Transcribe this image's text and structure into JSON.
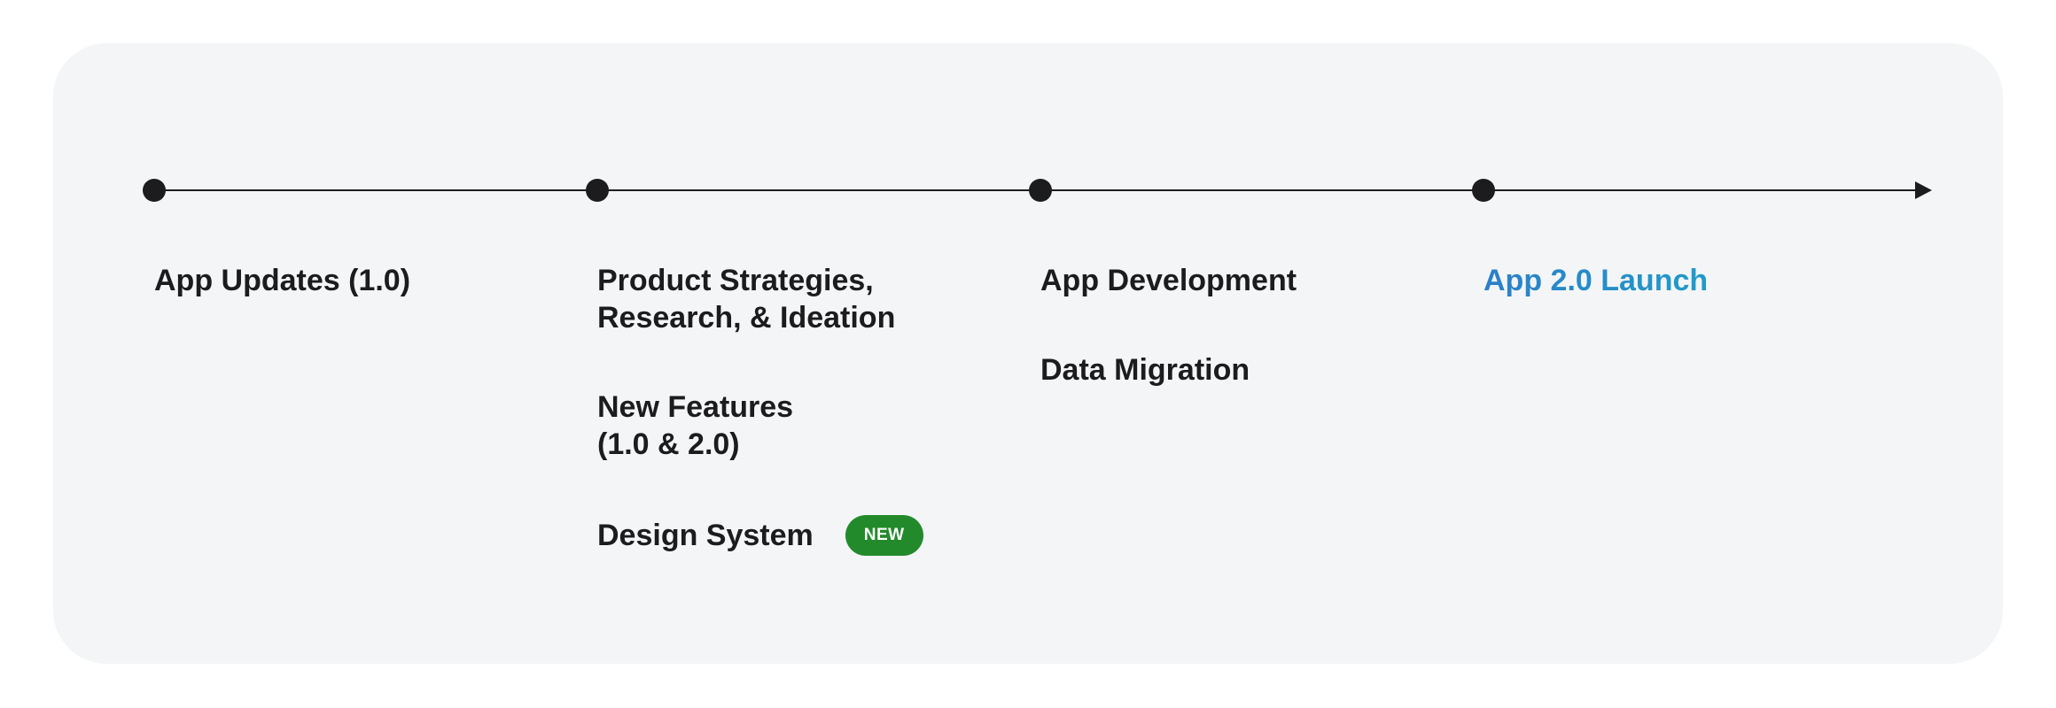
{
  "timeline": {
    "milestones": [
      {
        "items": [
          "App Updates (1.0)"
        ]
      },
      {
        "items": [
          "Product Strategies,\nResearch, & Ideation",
          "New Features\n(1.0 & 2.0)"
        ],
        "badged_item": "Design System",
        "badge": "NEW"
      },
      {
        "items": [
          "App Development",
          "Data Migration"
        ]
      },
      {
        "items": [
          "App 2.0 Launch"
        ],
        "highlighted": true
      }
    ]
  },
  "colors": {
    "card_background": "#f4f5f7",
    "text": "#1c1c1e",
    "line": "#1c1c1e",
    "badge": "#238a2b",
    "highlight_start": "#2b80c8",
    "highlight_end": "#18b3c9"
  }
}
